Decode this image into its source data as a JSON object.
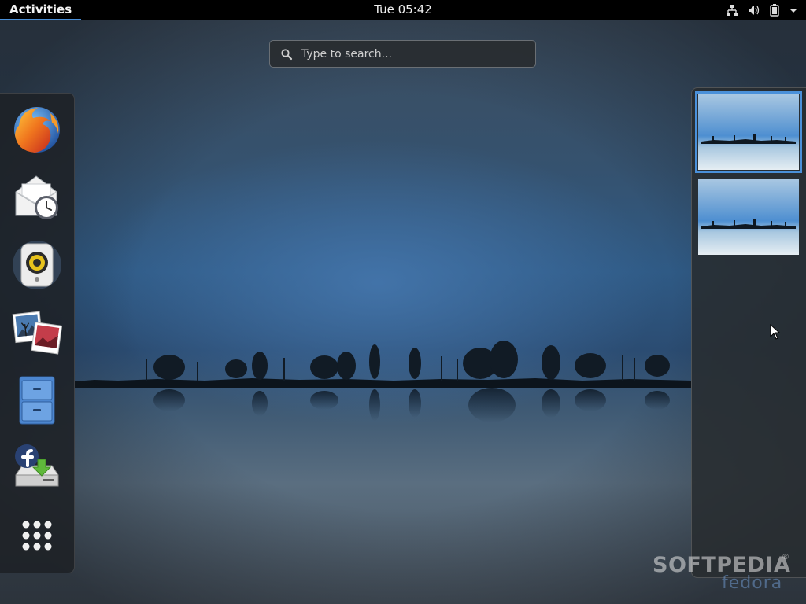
{
  "topbar": {
    "activities_label": "Activities",
    "clock": "Tue 05:42",
    "indicators": [
      "network-icon",
      "volume-icon",
      "battery-icon",
      "system-menu-arrow-icon"
    ]
  },
  "search": {
    "placeholder": "Type to search...",
    "value": ""
  },
  "dash": {
    "items": [
      {
        "name": "Firefox",
        "icon": "firefox-icon"
      },
      {
        "name": "Evolution",
        "icon": "mail-clock-icon"
      },
      {
        "name": "Rhythmbox",
        "icon": "speaker-icon"
      },
      {
        "name": "Shotwell",
        "icon": "photos-icon"
      },
      {
        "name": "Files",
        "icon": "file-cabinet-icon"
      },
      {
        "name": "Install to Hard Drive",
        "icon": "fedora-install-icon"
      },
      {
        "name": "Show Applications",
        "icon": "app-grid-icon"
      }
    ]
  },
  "workspaces": {
    "count": 2,
    "active_index": 0
  },
  "watermark": {
    "main": "SOFTPEDIA",
    "registered": "®",
    "sub": "fedora"
  },
  "colors": {
    "accent": "#4a90d9",
    "topbar": "#000000",
    "panel": "#1e2125"
  }
}
